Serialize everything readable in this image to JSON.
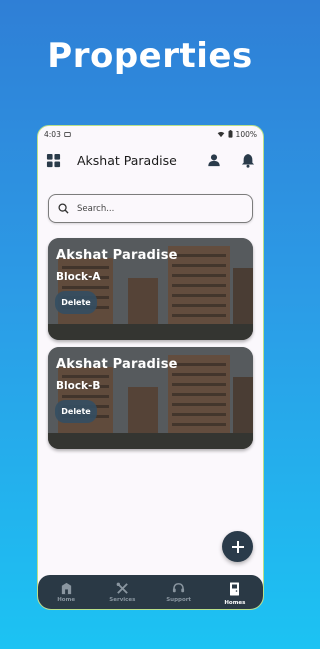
{
  "promo": {
    "title": "Properties"
  },
  "status": {
    "time": "4:03",
    "battery": "100%"
  },
  "appbar": {
    "title": "Akshat Paradise"
  },
  "search": {
    "placeholder": "Search..."
  },
  "cards": [
    {
      "title": "Akshat Paradise",
      "subtitle": "Block-A",
      "delete_label": "Delete"
    },
    {
      "title": "Akshat Paradise",
      "subtitle": "Block-B",
      "delete_label": "Delete"
    }
  ],
  "nav": {
    "items": [
      {
        "label": "Home",
        "icon": "building-icon"
      },
      {
        "label": "Services",
        "icon": "tools-icon"
      },
      {
        "label": "Support",
        "icon": "headset-icon"
      },
      {
        "label": "Homes",
        "icon": "door-icon",
        "active": true
      }
    ]
  },
  "colors": {
    "accent": "#2a3b4a",
    "background_top": "#2f7fd6",
    "background_bottom": "#1cc3f3"
  }
}
